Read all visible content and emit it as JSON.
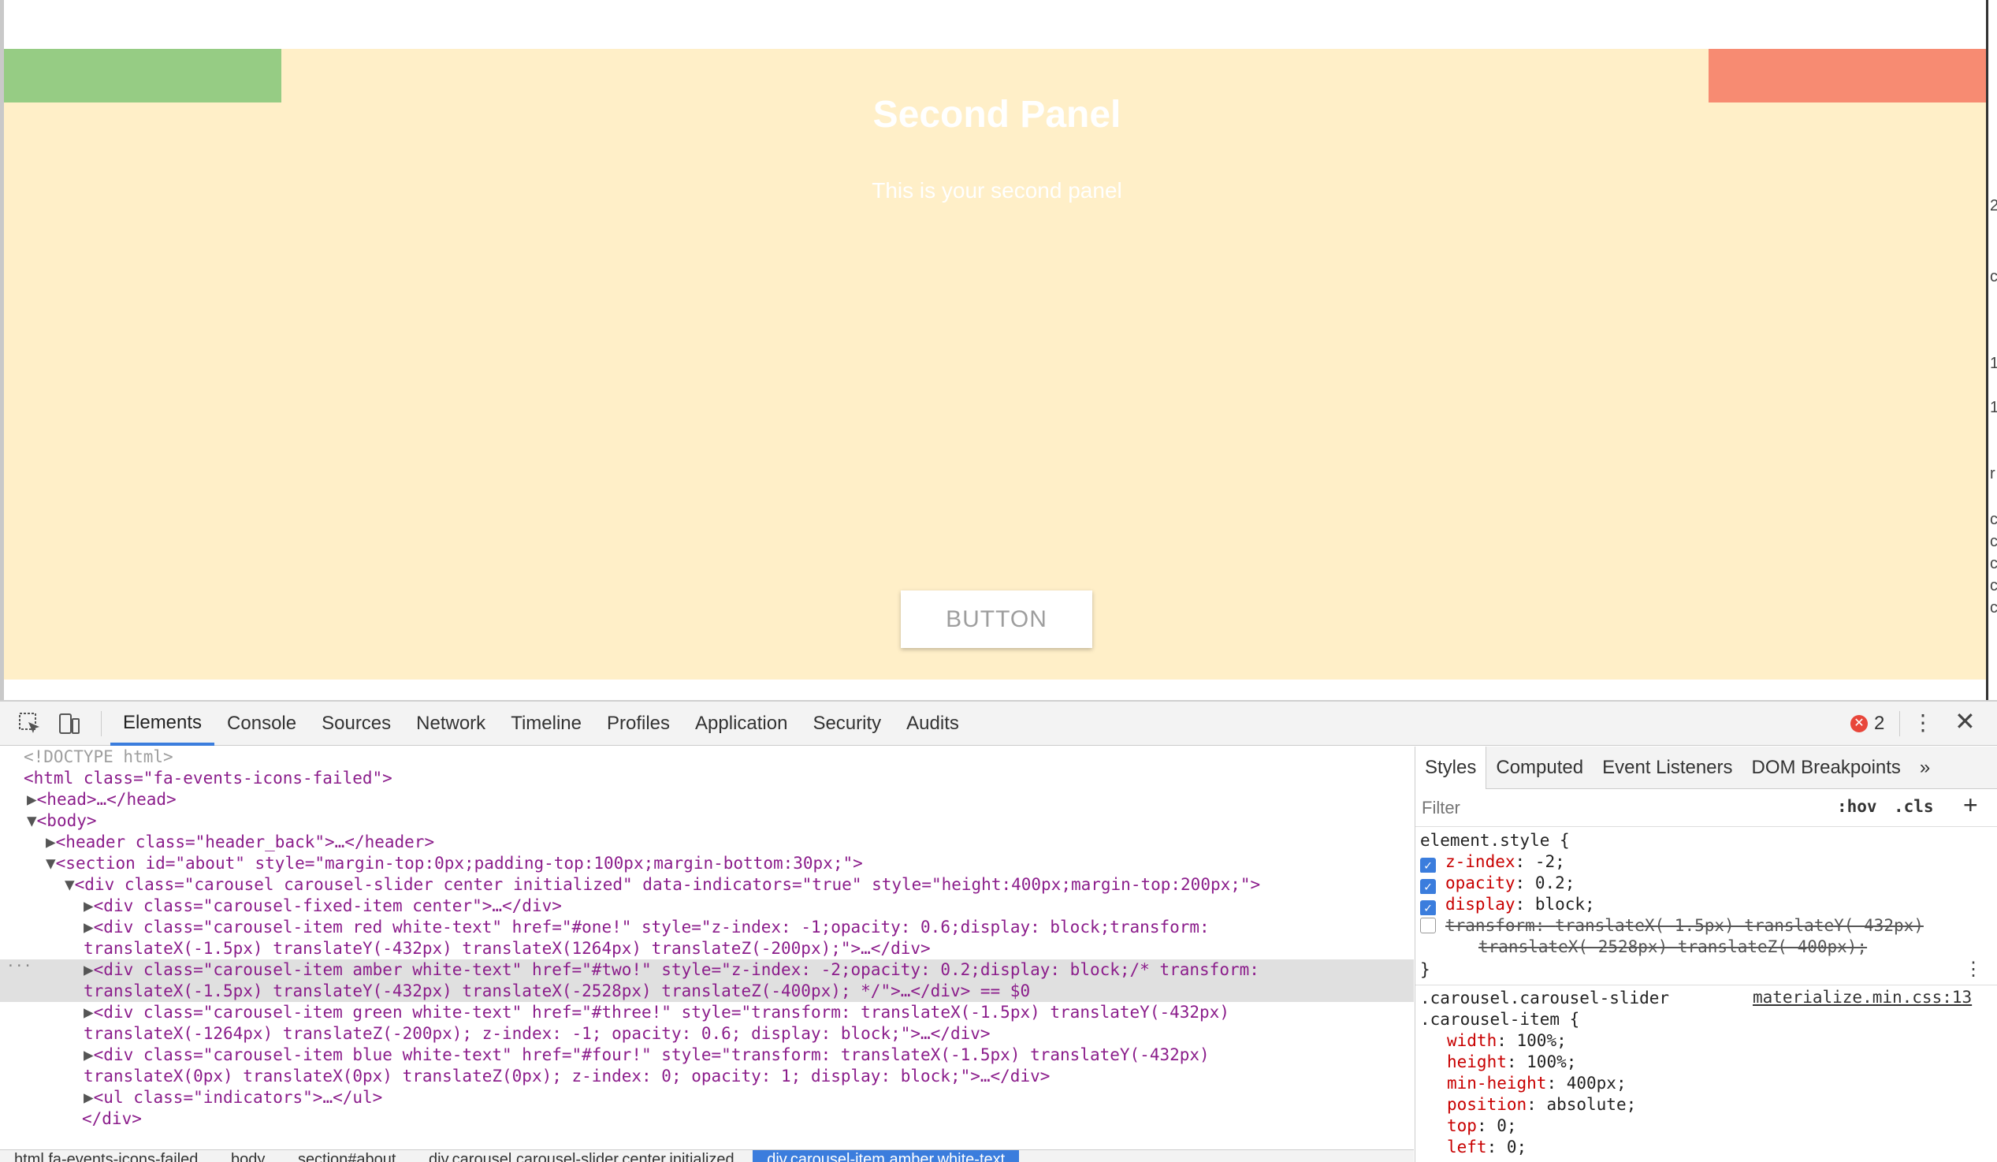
{
  "page": {
    "panel_title": "Second Panel",
    "panel_text": "This is your second panel",
    "button_label": "BUTTON",
    "colors": {
      "amber_slide": "#ffefc8",
      "green_peek": "#96cc84",
      "red_peek": "#f78b72"
    },
    "right_strip_glyphs": [
      "2",
      "c",
      "1",
      "1",
      "r",
      "c",
      "c",
      "c",
      "c",
      "c"
    ]
  },
  "devtools": {
    "tabs": [
      "Elements",
      "Console",
      "Sources",
      "Network",
      "Timeline",
      "Profiles",
      "Application",
      "Security",
      "Audits"
    ],
    "active_tab": "Elements",
    "error_count": "2",
    "more_icon": "⋮",
    "close_icon": "✕",
    "elements_lines": [
      "<!DOCTYPE html>",
      "<html class=\"fa-events-icons-failed\">",
      "<head>…</head>",
      "<body>",
      "<header class=\"header_back\">…</header>",
      "<section id=\"about\" style=\"margin-top:0px;padding-top:100px;margin-bottom:30px;\">",
      "<div class=\"carousel carousel-slider center initialized\" data-indicators=\"true\" style=\"height:400px;margin-top:200px;\">",
      "<div class=\"carousel-fixed-item center\">…</div>",
      "<div class=\"carousel-item red white-text\" href=\"#one!\" style=\"z-index: -1;opacity: 0.6;display: block;transform:",
      "translateX(-1.5px) translateY(-432px) translateX(1264px) translateZ(-200px);\">…</div>",
      "<div class=\"carousel-item amber white-text\" href=\"#two!\" style=\"z-index: -2;opacity: 0.2;display: block;/* transform:",
      "translateX(-1.5px) translateY(-432px) translateX(-2528px) translateZ(-400px); */\">…</div> == $0",
      "<div class=\"carousel-item green white-text\" href=\"#three!\" style=\"transform: translateX(-1.5px) translateY(-432px)",
      "translateX(-1264px) translateZ(-200px); z-index: -1; opacity: 0.6; display: block;\">…</div>",
      "<div class=\"carousel-item blue white-text\" href=\"#four!\" style=\"transform: translateX(-1.5px) translateY(-432px)",
      "translateX(0px) translateX(0px) translateZ(0px); z-index: 0; opacity: 1; display: block;\">…</div>",
      "<ul class=\"indicators\">…</ul>",
      "</div>"
    ],
    "breadcrumbs": [
      "html.fa-events-icons-failed",
      "body",
      "section#about",
      "div.carousel.carousel-slider.center.initialized",
      "div.carousel-item.amber.white-text"
    ],
    "styles": {
      "tabs": [
        "Styles",
        "Computed",
        "Event Listeners",
        "DOM Breakpoints"
      ],
      "more_tabs": "»",
      "filter_placeholder": "Filter",
      "hov": ":hov",
      "cls": ".cls",
      "add": "+",
      "element_style_header": "element.style {",
      "element_style_props": [
        {
          "name": "z-index",
          "value": "-2;",
          "enabled": true
        },
        {
          "name": "opacity",
          "value": "0.2;",
          "enabled": true
        },
        {
          "name": "display",
          "value": "block;",
          "enabled": true
        },
        {
          "name": "transform",
          "value": "translateX(-1.5px) translateY(-432px)",
          "enabled": false
        }
      ],
      "transform_continuation": "translateX(-2528px) translateZ(-400px);",
      "close_brace": "}",
      "rule_selector_1": ".carousel.carousel-slider",
      "rule_selector_2": ".carousel-item {",
      "rule_source": "materialize.min.css:13",
      "rule_props": [
        {
          "name": "width",
          "value": "100%;"
        },
        {
          "name": "height",
          "value": "100%;"
        },
        {
          "name": "min-height",
          "value": "400px;"
        },
        {
          "name": "position",
          "value": "absolute;"
        },
        {
          "name": "top",
          "value": "0;"
        },
        {
          "name": "left",
          "value": "0;"
        }
      ]
    }
  }
}
